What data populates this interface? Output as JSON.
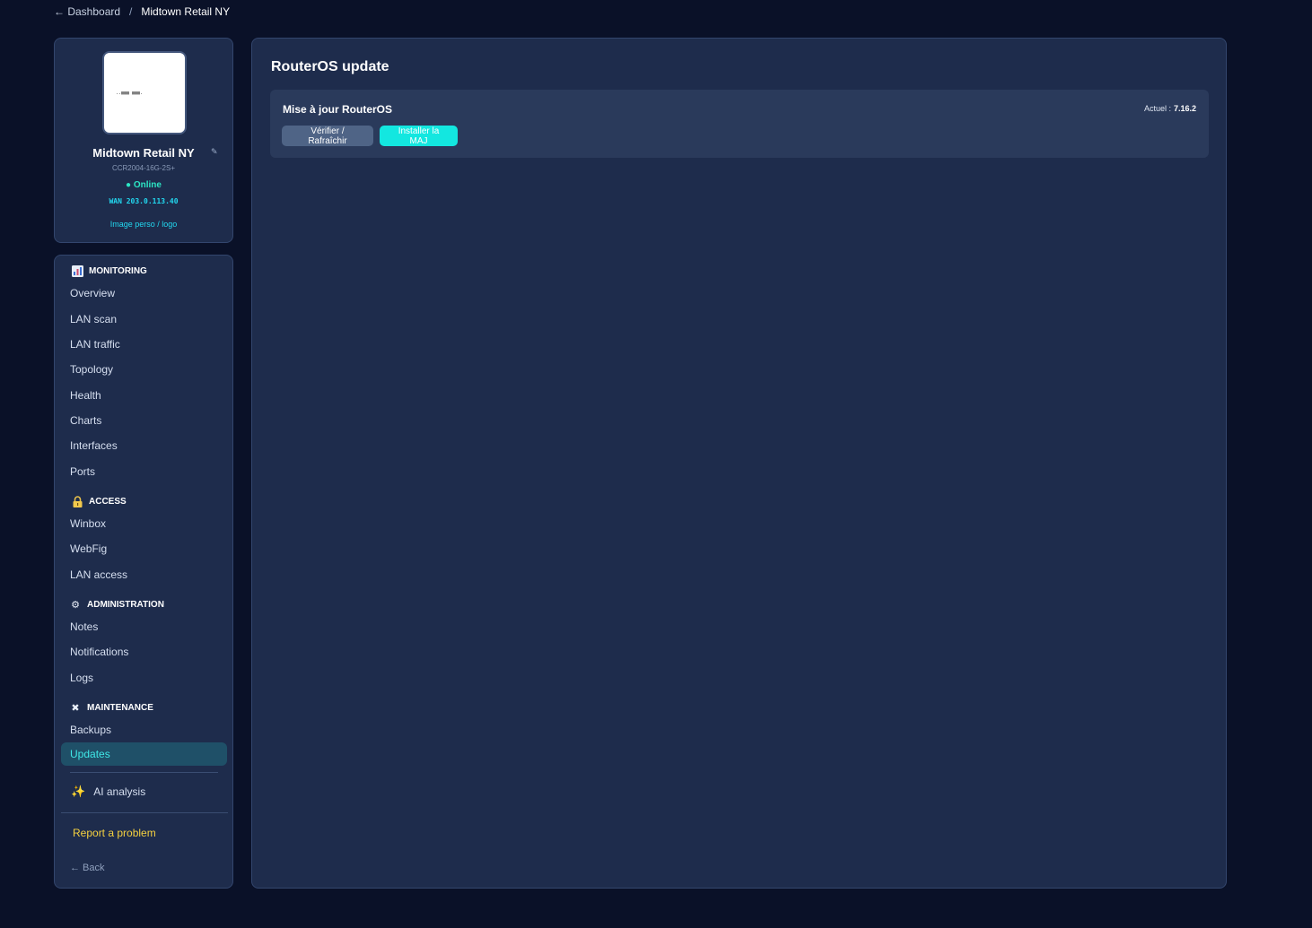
{
  "breadcrumb": {
    "back_label": "← Dashboard",
    "separator": "/",
    "current": "Midtown Retail NY"
  },
  "device": {
    "name": "Midtown Retail NY",
    "model": "CCR2004-16G-2S+",
    "status": "● Online",
    "wan": "WAN 203.0.113.40",
    "logo_link": "Image perso / logo",
    "image_caption": "..▥▥▥ ▥▥▥."
  },
  "nav": {
    "sections": {
      "monitoring": "MONITORING",
      "access": "ACCESS",
      "administration": "ADMINISTRATION",
      "maintenance": "MAINTENANCE"
    },
    "items": {
      "overview": "Overview",
      "lan_scan": "LAN scan",
      "lan_traffic": "LAN traffic",
      "topology": "Topology",
      "health": "Health",
      "charts": "Charts",
      "interfaces": "Interfaces",
      "ports": "Ports",
      "winbox": "Winbox",
      "webfig": "WebFig",
      "lan_access": "LAN access",
      "notes": "Notes",
      "notifications": "Notifications",
      "logs": "Logs",
      "backups": "Backups",
      "updates": "Updates"
    },
    "ai_analysis": "AI analysis",
    "report_problem": "Report a problem",
    "back": "← Back"
  },
  "main": {
    "title": "RouterOS update",
    "panel": {
      "title": "Mise à jour RouterOS",
      "current_label": "Actuel :",
      "current_version": "7.16.2",
      "refresh_button": "Vérifier / Rafraîchir",
      "install_button": "Installer la MAJ"
    }
  },
  "colors": {
    "background": "#0a1128",
    "panel": "#1e2c4c",
    "accent": "#13e7e0",
    "online": "#2ce6c4",
    "report": "#f4d03f"
  },
  "icons": {
    "monitoring": "bar-chart-icon",
    "access": "lock-icon",
    "administration": "gear-icon",
    "maintenance": "wrench-icon",
    "ai": "sparkles-icon",
    "edit": "pencil-icon"
  }
}
